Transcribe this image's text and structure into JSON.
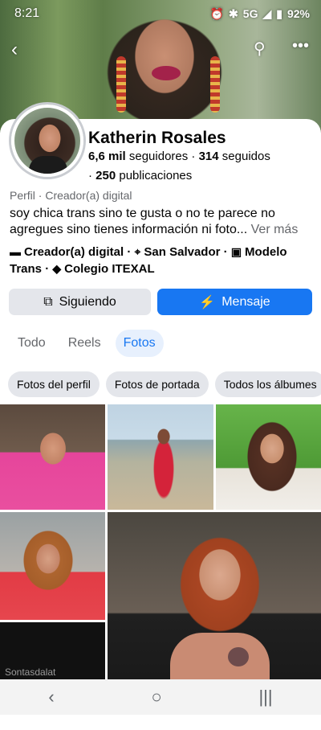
{
  "status": {
    "time": "8:21",
    "network": "5G",
    "battery": "92%"
  },
  "profile": {
    "name": "Katherin Rosales",
    "followers_num": "6,6 mil",
    "followers_label": " seguidores · ",
    "following_num": "314",
    "following_label": " seguidos",
    "posts_prefix": "· ",
    "posts_num": "250",
    "posts_label": " publicaciones",
    "category": "Perfil · Creador(a) digital",
    "bio": "soy chica trans sino te gusta o no te parece no agregues sino tienes información ni foto...",
    "bio_more": "Ver más",
    "detail_creator": "Creador(a) digital",
    "detail_sep1": " · ",
    "detail_location": "San Salvador",
    "detail_sep2": " · ",
    "detail_work": "Modelo Trans",
    "detail_sep3": " · ",
    "detail_school": "Colegio ITEXAL"
  },
  "actions": {
    "following_label": "Siguiendo",
    "message_label": "Mensaje"
  },
  "tabs": [
    "Todo",
    "Reels",
    "Fotos"
  ],
  "chips": [
    "Fotos del perfil",
    "Fotos de portada",
    "Todos los álbumes"
  ],
  "photo_caption": "Sontasdalat",
  "colors": {
    "accent": "#1877f2",
    "tab_active_bg": "#e7f0fd",
    "button_gray": "#e4e6eb"
  },
  "icons": [
    "back-icon",
    "search-icon",
    "more-icon",
    "messenger-icon",
    "following-icon",
    "category-icon",
    "location-icon",
    "work-icon",
    "school-icon"
  ]
}
